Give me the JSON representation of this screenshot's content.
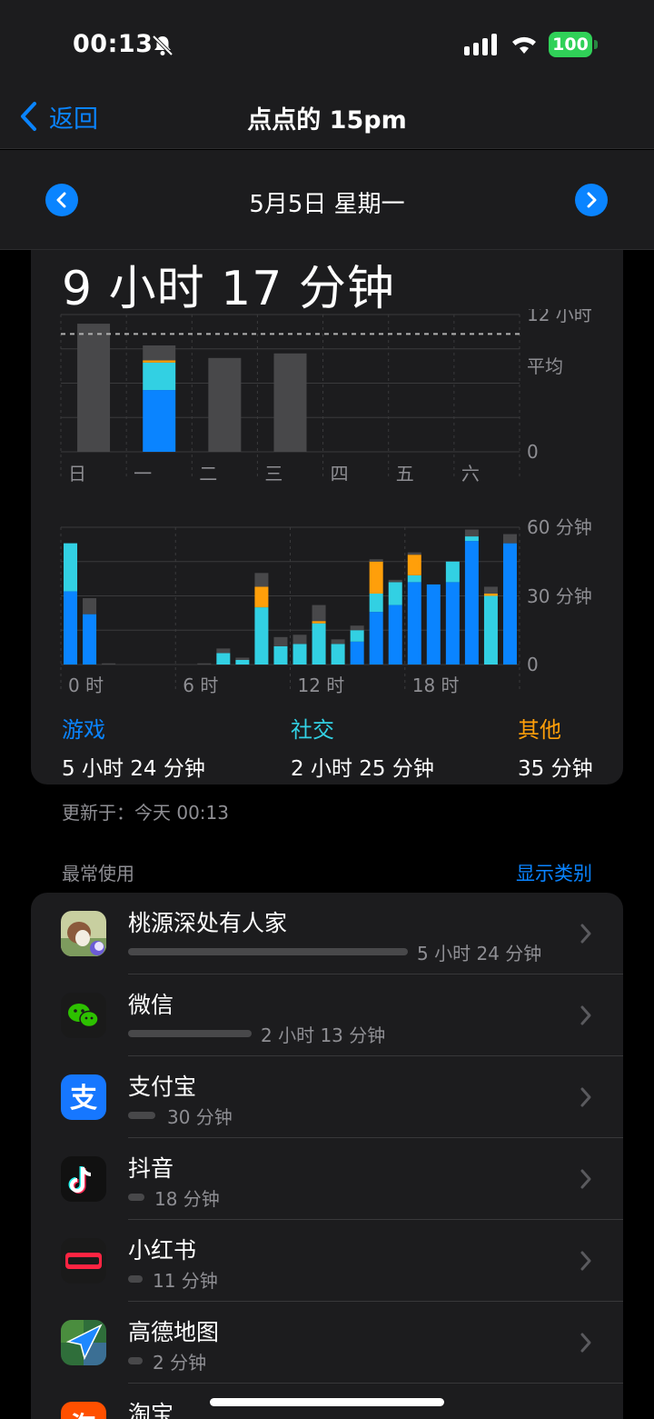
{
  "status": {
    "time": "00:13",
    "battery": "100"
  },
  "nav": {
    "back_label": "返回",
    "title": "点点的 15pm"
  },
  "date": {
    "label": "5月5日 星期一"
  },
  "summary": {
    "total": "9 小时 17 分钟"
  },
  "week_chart": {
    "y_top": "12 小时",
    "avg_label": "平均",
    "y_zero": "0",
    "days": [
      "日",
      "一",
      "二",
      "三",
      "四",
      "五",
      "六"
    ]
  },
  "hour_chart": {
    "y_top": "60 分钟",
    "y_mid": "30 分钟",
    "y_zero": "0",
    "x_labels": [
      "0 时",
      "6 时",
      "12 时",
      "18 时"
    ]
  },
  "categories": [
    {
      "name": "游戏",
      "time": "5 小时 24 分钟",
      "color": "#0a84ff"
    },
    {
      "name": "社交",
      "time": "2 小时 25 分钟",
      "color": "#32d0e3"
    },
    {
      "name": "其他",
      "time": "35 分钟",
      "color": "#ff9f0a"
    }
  ],
  "updated": "更新于：今天 00:13",
  "most_used": {
    "header": "最常使用",
    "show_categories": "显示类别",
    "apps": [
      {
        "name": "桃源深处有人家",
        "duration": "5 小时 24 分钟",
        "icon": "peach-garden-icon",
        "share": 1.0
      },
      {
        "name": "微信",
        "duration": "2 小时 13 分钟",
        "icon": "wechat-icon",
        "share": 0.41
      },
      {
        "name": "支付宝",
        "duration": "30 分钟",
        "icon": "alipay-icon",
        "share": 0.09
      },
      {
        "name": "抖音",
        "duration": "18 分钟",
        "icon": "douyin-icon",
        "share": 0.06
      },
      {
        "name": "小红书",
        "duration": "11 分钟",
        "icon": "xiaohongshu-icon",
        "share": 0.05
      },
      {
        "name": "高德地图",
        "duration": "2 分钟",
        "icon": "amap-icon",
        "share": 0.05
      },
      {
        "name": "淘宝",
        "duration": "",
        "icon": "taobao-icon",
        "share": 0
      }
    ]
  },
  "colors": {
    "game": "#0a84ff",
    "social": "#32d0e3",
    "other": "#ff9f0a",
    "rest": "#48484a",
    "accent": "#0a84ff"
  },
  "chart_data": [
    {
      "type": "bar",
      "categories": [
        "日",
        "一",
        "二",
        "三",
        "四",
        "五",
        "六"
      ],
      "ylim": [
        0,
        12
      ],
      "ylabel": "",
      "average_hours": 10.3,
      "series": [
        {
          "name": "游戏",
          "values": [
            0,
            5.4,
            0,
            0,
            0,
            0,
            0
          ]
        },
        {
          "name": "社交",
          "values": [
            0,
            2.4,
            0,
            0,
            0,
            0,
            0
          ]
        },
        {
          "name": "其他",
          "values": [
            0,
            0.2,
            0,
            0,
            0,
            0,
            0
          ]
        },
        {
          "values": [
            11.2,
            1.3,
            8.2,
            8.6,
            0,
            0,
            0
          ]
        }
      ]
    },
    {
      "type": "bar",
      "categories": [
        "0",
        "1",
        "2",
        "3",
        "4",
        "5",
        "6",
        "7",
        "8",
        "9",
        "10",
        "11",
        "12",
        "13",
        "14",
        "15",
        "16",
        "17",
        "18",
        "19",
        "20",
        "21",
        "22",
        "23"
      ],
      "ylim": [
        0,
        60
      ],
      "ylabel": "",
      "series": [
        {
          "name": "游戏",
          "values": [
            32,
            22,
            0,
            0,
            0,
            0,
            0,
            0,
            0,
            0,
            0,
            0,
            0,
            0,
            0,
            10,
            23,
            26,
            36,
            35,
            36,
            54,
            0,
            53
          ]
        },
        {
          "name": "社交",
          "values": [
            21,
            0,
            0,
            0,
            0,
            0,
            0,
            0,
            5,
            2,
            25,
            8,
            9,
            18,
            9,
            5,
            8,
            10,
            3,
            0,
            9,
            2,
            30,
            0
          ]
        },
        {
          "name": "其他",
          "values": [
            0,
            0,
            0,
            0,
            0,
            0,
            0,
            0,
            0,
            0,
            9,
            0,
            0,
            1,
            0,
            0,
            14,
            0,
            9,
            0,
            0,
            0,
            1,
            0
          ]
        },
        {
          "values": [
            0,
            7,
            0.5,
            0,
            0,
            0,
            0,
            0.5,
            2,
            1,
            6,
            4,
            4,
            7,
            2,
            2,
            1,
            1,
            1,
            0,
            0,
            3,
            3,
            4
          ]
        }
      ]
    }
  ]
}
